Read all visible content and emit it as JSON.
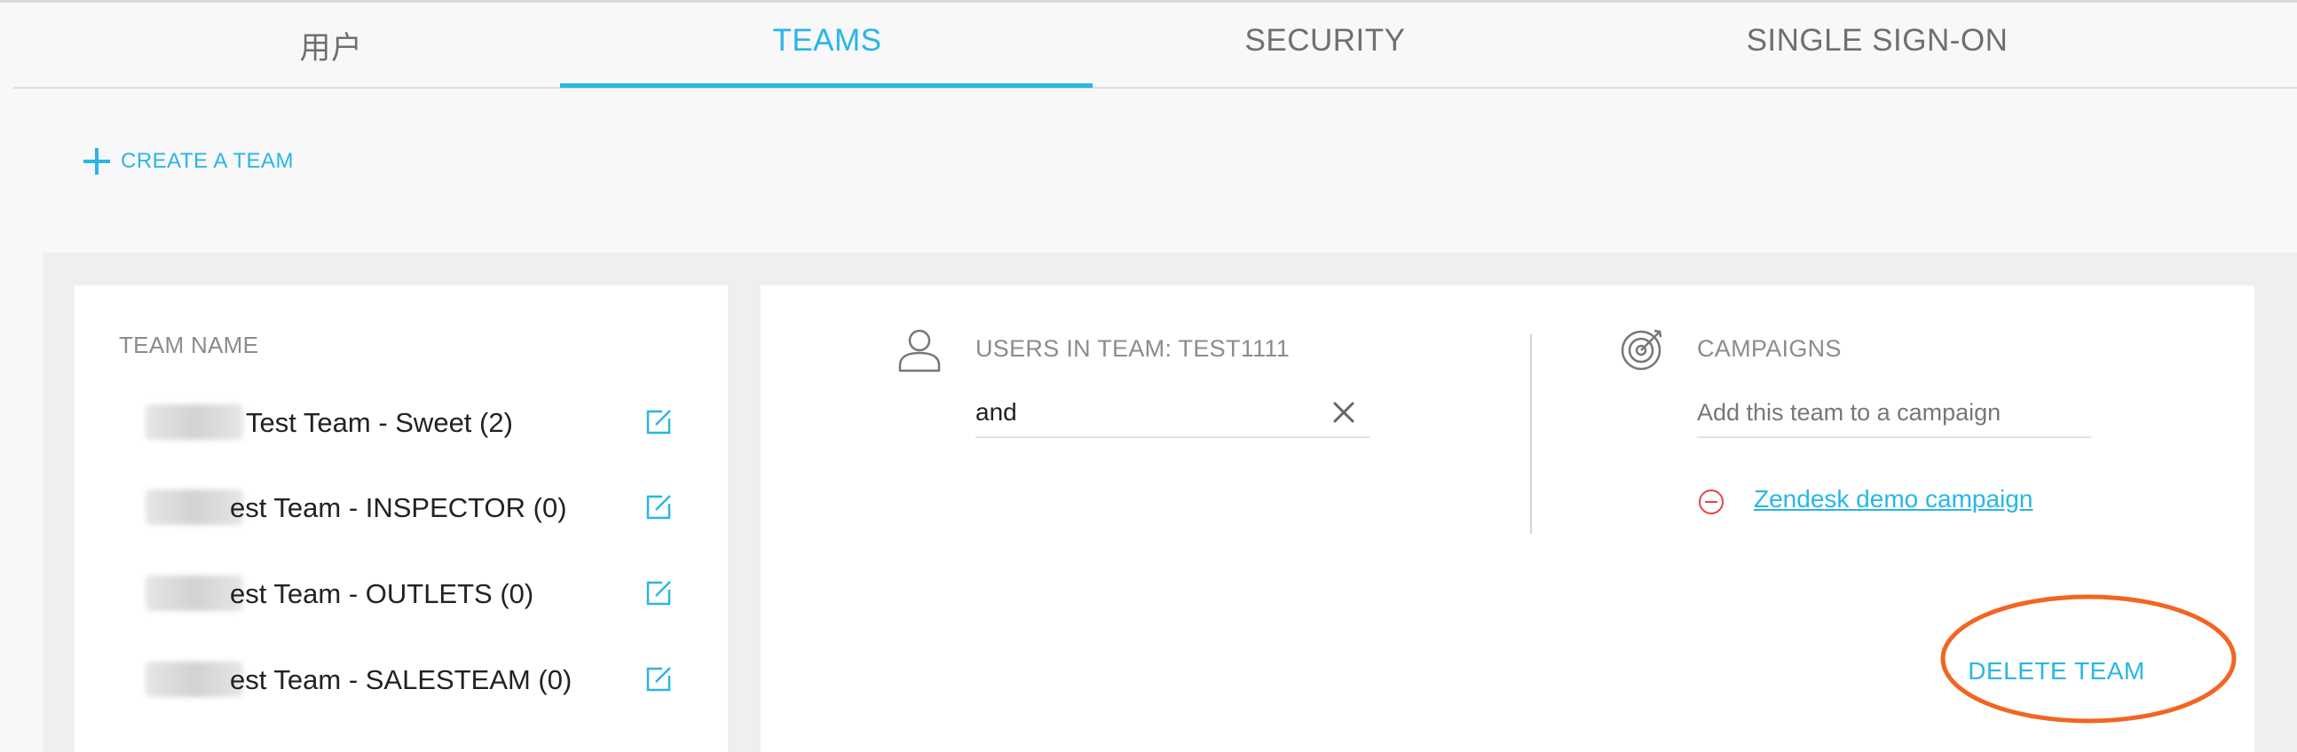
{
  "tabs": [
    {
      "label": "用户",
      "active": false
    },
    {
      "label": "TEAMS",
      "active": true
    },
    {
      "label": "SECURITY",
      "active": false
    },
    {
      "label": "SINGLE SIGN-ON",
      "active": false
    }
  ],
  "create_team": {
    "label": "CREATE A TEAM",
    "icon": "plus-icon"
  },
  "team_list": {
    "header": "TEAM NAME",
    "teams": [
      {
        "name": "Test Team - Sweet (2)"
      },
      {
        "name": "est Team - INSPECTOR (0)"
      },
      {
        "name": "est Team - OUTLETS (0)"
      },
      {
        "name": "est Team - SALESTEAM (0)"
      }
    ]
  },
  "users_section": {
    "title": "USERS IN TEAM: TEST1111",
    "search_value": "and",
    "icon": "user-icon"
  },
  "campaigns_section": {
    "title": "CAMPAIGNS",
    "input_placeholder": "Add this team to a campaign",
    "icon": "target-icon",
    "campaigns": [
      {
        "name": "Zendesk demo campaign"
      }
    ]
  },
  "delete_button": {
    "label": "DELETE TEAM"
  },
  "colors": {
    "accent": "#29b6e6",
    "danger": "#e64545",
    "highlight": "#f26522",
    "text": "#222222",
    "muted": "#8c8c8c"
  }
}
